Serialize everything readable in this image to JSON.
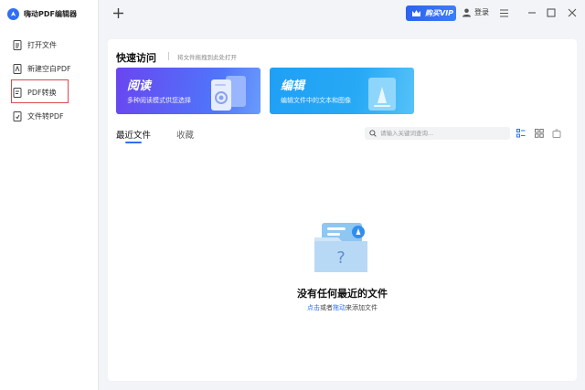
{
  "app": {
    "name": "嗨动PDF编辑器"
  },
  "sidebar": {
    "items": [
      {
        "label": "打开文件",
        "icon": "open-file-icon"
      },
      {
        "label": "新建空白PDF",
        "icon": "new-pdf-icon"
      },
      {
        "label": "PDF转换",
        "icon": "pdf-convert-icon",
        "highlighted": true
      },
      {
        "label": "文件转PDF",
        "icon": "file-to-pdf-icon"
      }
    ]
  },
  "topbar": {
    "new_tab_icon": "plus-icon",
    "vip_label": "购买VIP",
    "login_label": "登录",
    "window_icons": [
      "menu-icon",
      "minimize-icon",
      "maximize-icon",
      "close-icon"
    ]
  },
  "quick_access": {
    "title": "快速访问",
    "hint": "将文件拖拽到此处打开",
    "cards": [
      {
        "title": "阅读",
        "desc": "多种阅读模式供您选择"
      },
      {
        "title": "编辑",
        "desc": "编辑文件中的文本和图像"
      }
    ]
  },
  "tabs": {
    "recent": "最近文件",
    "favorites": "收藏"
  },
  "search": {
    "placeholder": "请输入关键词查询..."
  },
  "empty": {
    "title": "没有任何最近的文件",
    "click": "点击",
    "or": "或者",
    "drag": "拖动",
    "suffix": "来添加文件"
  },
  "colors": {
    "accent": "#2f6ff3",
    "highlight_border": "#d94b4b"
  }
}
